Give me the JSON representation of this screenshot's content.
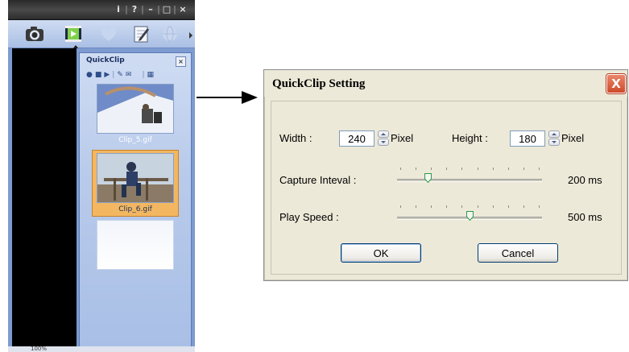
{
  "app": {
    "titlebar_buttons": [
      "i",
      "?",
      "–",
      "□",
      "×"
    ],
    "toolbar_icons": [
      "camera-icon",
      "film-icon",
      "heart-icon",
      "notepad-icon",
      "globe-icon"
    ],
    "quickclip": {
      "title": "QuickClip",
      "close": "×",
      "controls": [
        "record-icon",
        "stop-icon",
        "play-icon",
        "edit-icon",
        "email-icon",
        "grid-icon"
      ],
      "clips": [
        {
          "label": "Clip_5.gif",
          "selected": false
        },
        {
          "label": "Clip_6.gif",
          "selected": true
        },
        {
          "label": "",
          "selected": false
        }
      ]
    },
    "status": "100%"
  },
  "dialog": {
    "title": "QuickClip Setting",
    "close": "X",
    "width_label": "Width :",
    "width_value": "240",
    "height_label": "Height :",
    "height_value": "180",
    "pixel_label_1": "Pixel",
    "pixel_label_2": "Pixel",
    "capture_label": "Capture Inteval :",
    "capture_value": "200 ms",
    "capture_position": 0.2,
    "speed_label": "Play Speed :",
    "speed_value": "500 ms",
    "speed_position": 0.5,
    "ok_label": "OK",
    "cancel_label": "Cancel"
  },
  "colors": {
    "panel_blue": "#7d9bd0",
    "selection_orange": "#f2b760",
    "dialog_bg": "#ece9d8",
    "close_red": "#cf4a2c"
  }
}
